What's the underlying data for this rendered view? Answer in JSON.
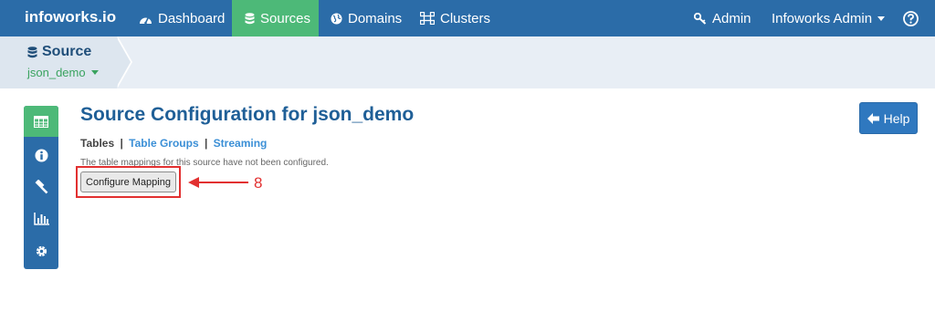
{
  "navbar": {
    "brand": "infoworks.io",
    "items": [
      {
        "label": "Dashboard",
        "icon": "dashboard-icon"
      },
      {
        "label": "Sources",
        "icon": "database-icon",
        "active": true
      },
      {
        "label": "Domains",
        "icon": "globe-icon"
      },
      {
        "label": "Clusters",
        "icon": "cluster-icon"
      }
    ],
    "admin_label": "Admin",
    "user_label": "Infoworks Admin",
    "help_icon": "question-circle-icon"
  },
  "source": {
    "title": "Source",
    "selected": "json_demo"
  },
  "rail": {
    "items": [
      "table-icon",
      "info-icon",
      "hammer-icon",
      "bar-chart-icon",
      "gear-icon"
    ]
  },
  "main": {
    "title": "Source Configuration for json_demo",
    "tabs": {
      "current": "Tables",
      "separator": "|",
      "table_groups": "Table Groups",
      "streaming": "Streaming"
    },
    "notice": "The table mappings for this source have not been configured.",
    "configure_button": "Configure Mapping",
    "annotation_number": "8",
    "help_button": "Help"
  },
  "colors": {
    "navbar": "#2b6ca8",
    "active": "#4db978",
    "title": "#1f5f97",
    "link": "#3b8fd6",
    "annotation": "#e23030"
  }
}
